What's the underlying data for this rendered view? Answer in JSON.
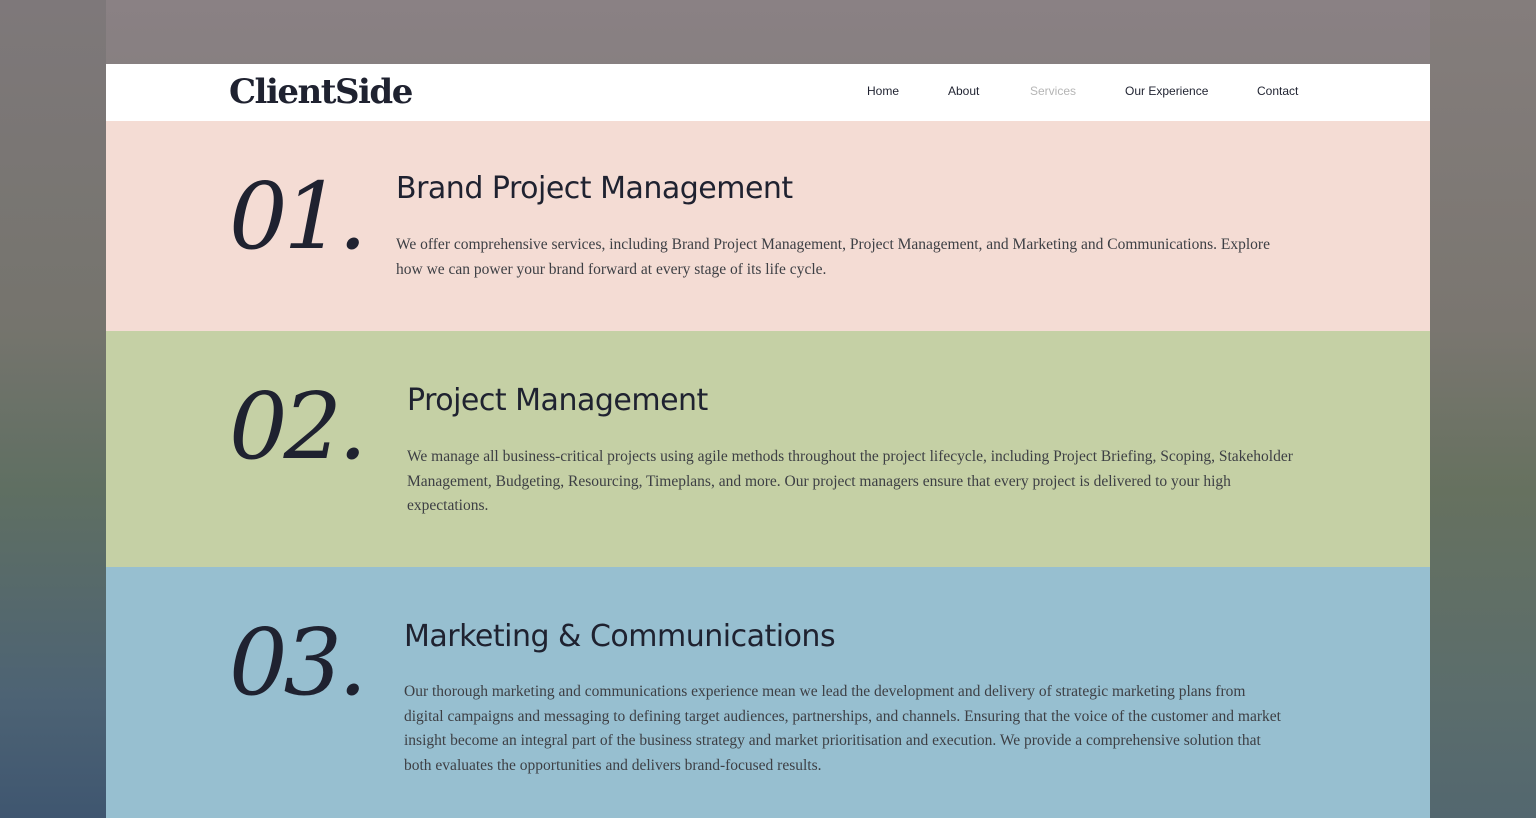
{
  "header": {
    "logo": "ClientSide",
    "nav": [
      {
        "label": "Home",
        "active": false
      },
      {
        "label": "About",
        "active": false
      },
      {
        "label": "Services",
        "active": true
      },
      {
        "label": "Our Experience",
        "active": false
      },
      {
        "label": "Contact",
        "active": false
      }
    ]
  },
  "sections": [
    {
      "number": "01.",
      "title": "Brand Project Management",
      "body": "We offer comprehensive services, including Brand Project Management, Project Management, and Marketing and Communications. Explore how we can power your brand forward at every stage of its life cycle.",
      "background": "#f4dcd4"
    },
    {
      "number": "02.",
      "title": "Project Management",
      "body": "We manage all business-critical projects using agile methods throughout the project lifecycle, including Project Briefing, Scoping, Stakeholder Management, Budgeting, Resourcing, Timeplans, and more. Our project managers ensure that every project is delivered to your high expectations.",
      "background": "#c5d0a5"
    },
    {
      "number": "03.",
      "title": "Marketing & Communications",
      "body": "Our thorough marketing and communications experience mean we lead the development and delivery of strategic marketing plans from digital campaigns and messaging to defining target audiences, partnerships, and channels. Ensuring that the voice of the customer and market insight become an integral part of the business strategy and market prioritisation and execution. We provide a comprehensive solution that both evaluates the opportunities and delivers brand-focused results.",
      "background": "#97bfd0"
    }
  ],
  "colors": {
    "text": "#1f2230",
    "nav_active": "#b5b5b5"
  }
}
